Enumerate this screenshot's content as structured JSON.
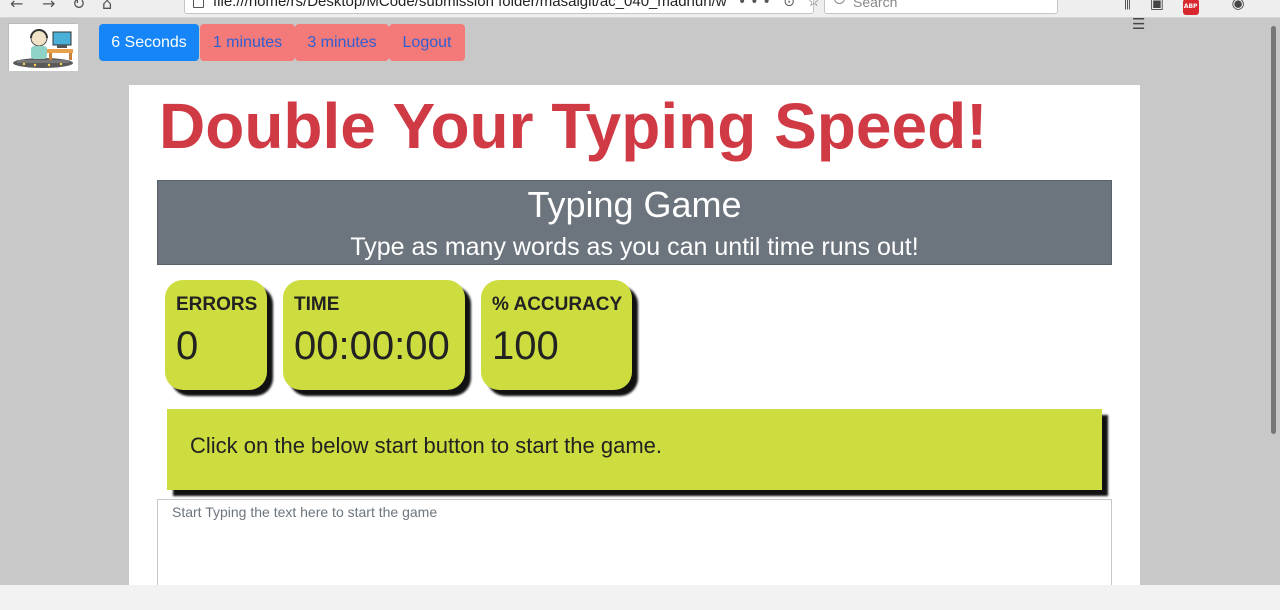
{
  "browser": {
    "url": "file:///home/rs/Desktop/MCode/submission folder/masaigit/ac_040_madhuri/w",
    "url_actions": "••• ⊙ ☆",
    "search_placeholder": "Search"
  },
  "nav": {
    "buttons": [
      "6 Seconds",
      "1 minutes",
      "3 minutes",
      "Logout"
    ],
    "active_color": "#1585f7",
    "inactive_color": "#f47a7a"
  },
  "page": {
    "headline": "Double Your Typing Speed!",
    "banner_title": "Typing Game",
    "banner_subtitle": "Type as many words as you can until time runs out!"
  },
  "stats": {
    "errors": {
      "label": "ERRORS",
      "value": "0"
    },
    "time": {
      "label": "TIME",
      "value": "00:00:00"
    },
    "accuracy": {
      "label": "% ACCURACY",
      "value": "100"
    }
  },
  "message": "Click on the below start button to start the game.",
  "input": {
    "placeholder": "Start Typing the text here to start the game",
    "value": ""
  },
  "colors": {
    "headline": "#d03a45",
    "banner": "#6c757d",
    "stat_box": "#cddc3f"
  }
}
